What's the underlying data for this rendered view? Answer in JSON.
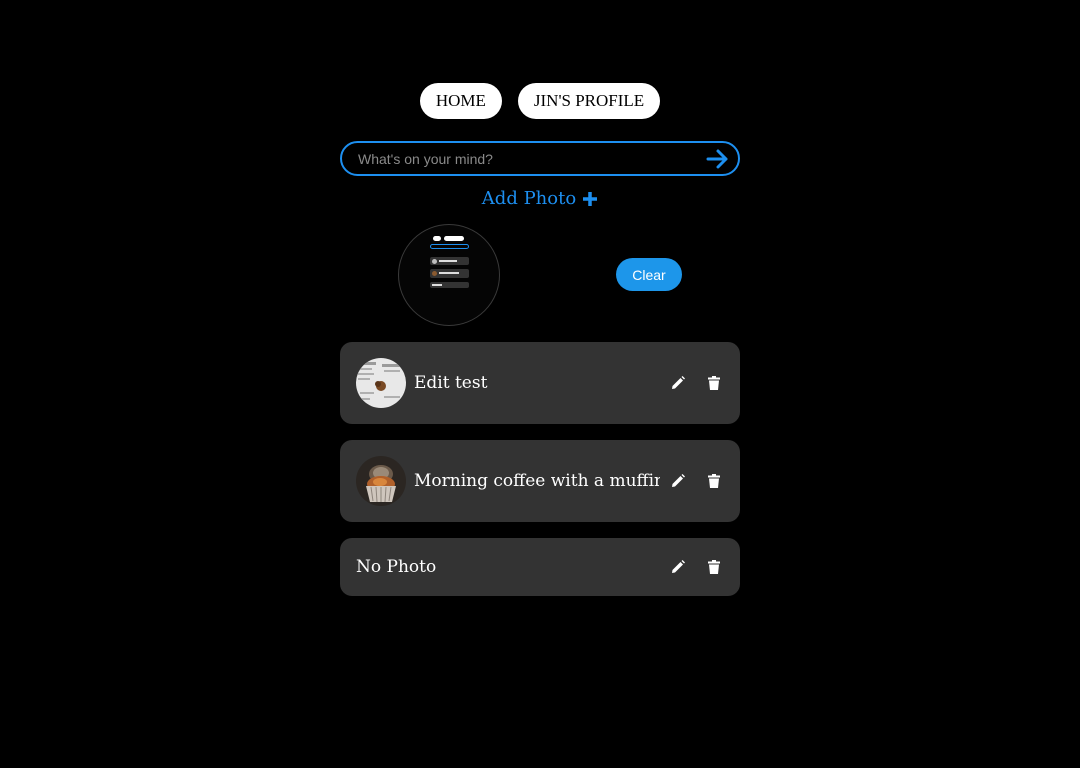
{
  "nav": {
    "home_label": "HOME",
    "profile_label": "JIN'S PROFILE"
  },
  "composer": {
    "placeholder": "What's on your mind?",
    "value": "",
    "submit_icon": "arrow-right-icon"
  },
  "add_photo": {
    "label": "Add Photo",
    "icon": "plus-icon"
  },
  "preview": {
    "clear_label": "Clear"
  },
  "posts": [
    {
      "text": "Edit test",
      "has_photo": true,
      "photo": "screenshot-collage"
    },
    {
      "text": "Morning coffee with a muffin",
      "has_photo": true,
      "photo": "muffin"
    },
    {
      "text": "No Photo",
      "has_photo": false
    }
  ],
  "colors": {
    "background": "#000000",
    "accent": "#1d8ff0",
    "clear_button": "#1d96ea",
    "card": "#333333",
    "nav_button": "#ffffff"
  }
}
